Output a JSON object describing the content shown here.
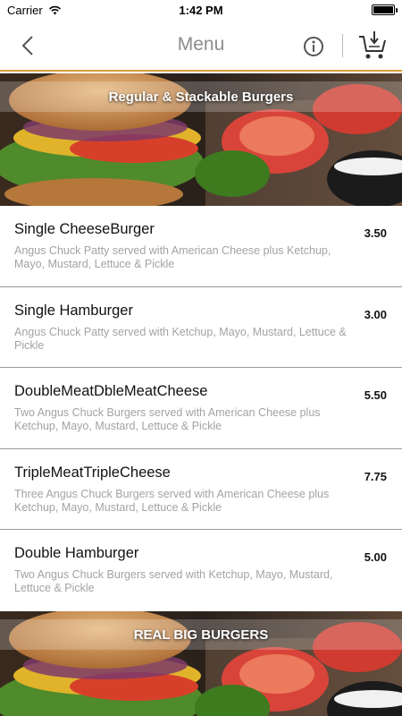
{
  "status_bar": {
    "carrier": "Carrier",
    "time": "1:42 PM",
    "wifi_icon": "wifi-icon",
    "battery_icon": "battery-icon"
  },
  "nav": {
    "title": "Menu",
    "back_icon": "chevron-left-icon",
    "info_icon": "info-icon",
    "cart_icon": "cart-add-icon",
    "accent_color": "#d9a037"
  },
  "categories": [
    {
      "title": "Regular & Stackable Burgers"
    },
    {
      "title": "REAL BIG BURGERS"
    }
  ],
  "items": [
    {
      "name": "Single CheeseBurger",
      "price": "3.50",
      "description": "Angus Chuck Patty served with American Cheese plus Ketchup, Mayo, Mustard, Lettuce & Pickle"
    },
    {
      "name": "Single Hamburger",
      "price": "3.00",
      "description": "Angus Chuck Patty served with Ketchup, Mayo, Mustard, Lettuce & Pickle"
    },
    {
      "name": "DoubleMeatDbleMeatCheese",
      "price": "5.50",
      "description": "Two Angus Chuck Burgers served with American Cheese plus Ketchup, Mayo, Mustard, Lettuce & Pickle"
    },
    {
      "name": "TripleMeatTripleCheese",
      "price": "7.75",
      "description": "Three Angus Chuck Burgers served with American Cheese plus Ketchup, Mayo, Mustard, Lettuce & Pickle"
    },
    {
      "name": "Double Hamburger",
      "price": "5.00",
      "description": "Two Angus Chuck Burgers served with Ketchup, Mayo, Mustard, Lettuce & Pickle"
    }
  ]
}
